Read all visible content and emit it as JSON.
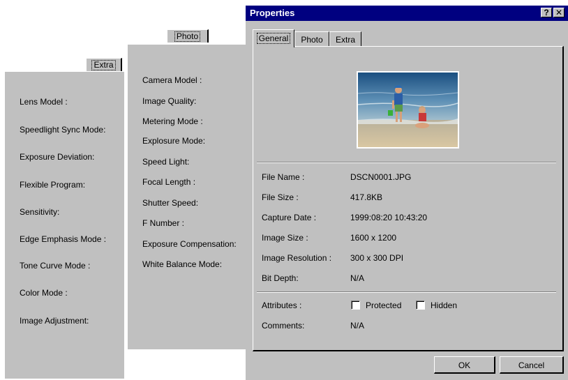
{
  "extra_panel": {
    "tab_label": "Extra",
    "rows": [
      "Lens Model :",
      "Speedlight Sync Mode:",
      "Exposure Deviation:",
      "Flexible Program:",
      "Sensitivity:",
      "Edge Emphasis Mode :",
      "Tone Curve Mode :",
      "Color Mode :",
      "Image Adjustment:"
    ]
  },
  "photo_panel": {
    "tab_label": "Photo",
    "rows": [
      "Camera Model :",
      "Image Quality:",
      "Metering Mode :",
      "Explosure Mode:",
      "Speed Light:",
      "Focal Length :",
      "Shutter Speed:",
      "F Number :",
      "Exposure Compensation:",
      "White Balance Mode:"
    ]
  },
  "dialog": {
    "title": "Properties",
    "help_glyph": "?",
    "close_glyph": "✕",
    "tabs": [
      {
        "label": "General",
        "active": true
      },
      {
        "label": "Photo",
        "active": false
      },
      {
        "label": "Extra",
        "active": false
      }
    ],
    "thumbnail": {
      "icon": "photo-thumbnail"
    },
    "fields": [
      {
        "label": "File Name :",
        "value": "DSCN0001.JPG"
      },
      {
        "label": "File Size :",
        "value": "417.8KB"
      },
      {
        "label": "Capture Date :",
        "value": "1999:08:20 10:43:20"
      },
      {
        "label": "Image Size :",
        "value": "1600 x 1200"
      },
      {
        "label": "Image Resolution :",
        "value": "300 x 300 DPI"
      },
      {
        "label": "Bit Depth:",
        "value": "N/A"
      }
    ],
    "attributes": {
      "label": "Attributes :",
      "protected_label": "Protected",
      "protected_checked": false,
      "hidden_label": "Hidden",
      "hidden_checked": false
    },
    "comments": {
      "label": "Comments:",
      "value": "N/A"
    },
    "ok_label": "OK",
    "cancel_label": "Cancel"
  },
  "colors": {
    "titlebar": "#000080",
    "face": "#c0c0c0"
  }
}
